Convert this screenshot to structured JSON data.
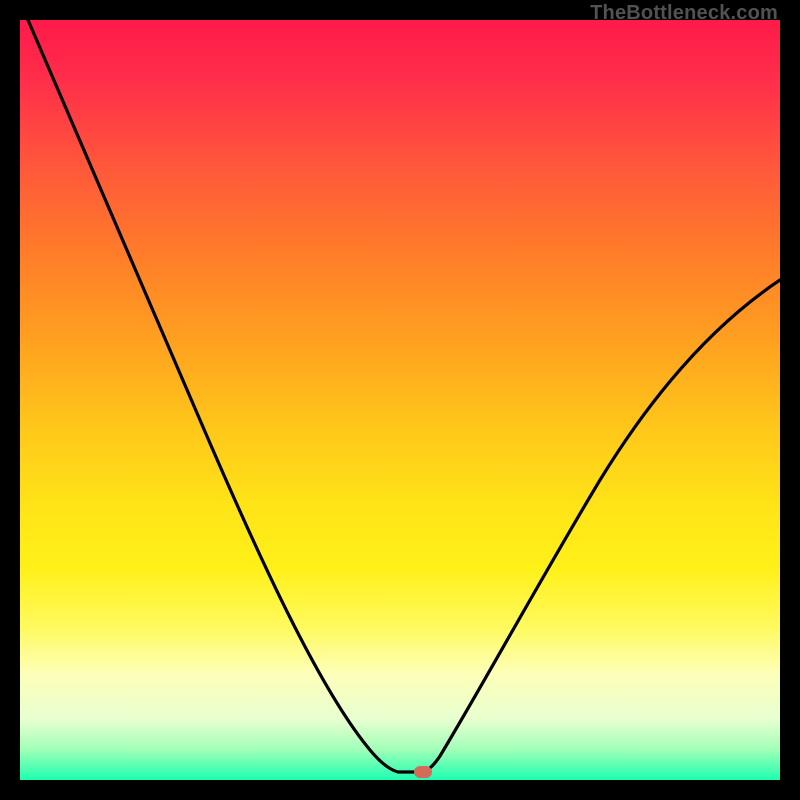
{
  "attribution": "TheBottleneck.com",
  "chart_data": {
    "type": "line",
    "title": "",
    "xlabel": "",
    "ylabel": "",
    "xlim": [
      0,
      100
    ],
    "ylim": [
      0,
      100
    ],
    "series": [
      {
        "name": "bottleneck-curve",
        "x": [
          0,
          10,
          20,
          30,
          40,
          45,
          48,
          50,
          52,
          54,
          56,
          60,
          68,
          78,
          88,
          100
        ],
        "y": [
          100,
          81,
          62,
          44,
          25,
          12,
          4,
          1,
          0.5,
          0.5,
          1,
          5,
          16,
          32,
          47,
          62
        ]
      }
    ],
    "marker": {
      "x": 53,
      "y": 0.3,
      "color": "#d46a5a"
    },
    "gradient_stops": [
      {
        "pos": 0,
        "color": "#ff1a4a"
      },
      {
        "pos": 50,
        "color": "#ffd418"
      },
      {
        "pos": 100,
        "color": "#1cffb0"
      }
    ]
  }
}
